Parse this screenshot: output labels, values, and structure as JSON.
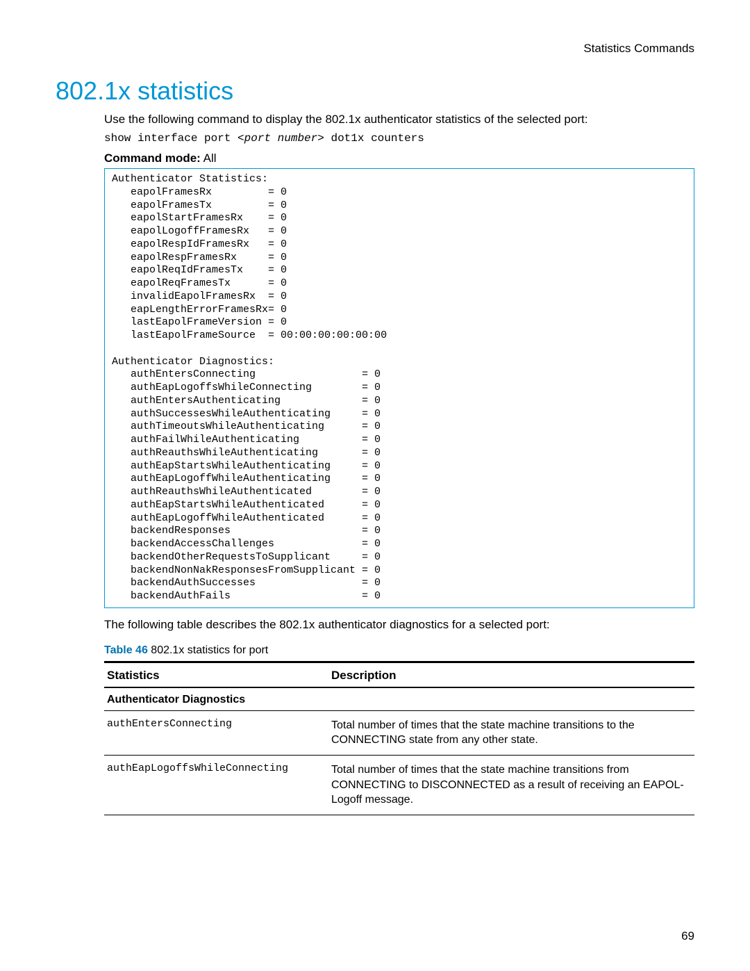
{
  "header": {
    "right_text": "Statistics Commands"
  },
  "title": "802.1x statistics",
  "intro": "Use the following command to display the 802.1x authenticator statistics of the selected port:",
  "command": {
    "prefix": "show interface port ",
    "arg": "<port number>",
    "suffix": " dot1x counters"
  },
  "mode": {
    "label": "Command mode:",
    "value": " All"
  },
  "output": {
    "stats_header": "Authenticator Statistics:",
    "stats": [
      {
        "k": "eapolFramesRx",
        "v": "0"
      },
      {
        "k": "eapolFramesTx",
        "v": "0"
      },
      {
        "k": "eapolStartFramesRx",
        "v": "0"
      },
      {
        "k": "eapolLogoffFramesRx",
        "v": "0"
      },
      {
        "k": "eapolRespIdFramesRx",
        "v": "0"
      },
      {
        "k": "eapolRespFramesRx",
        "v": "0"
      },
      {
        "k": "eapolReqIdFramesTx",
        "v": "0"
      },
      {
        "k": "eapolReqFramesTx",
        "v": "0"
      },
      {
        "k": "invalidEapolFramesRx",
        "v": "0"
      },
      {
        "k": "eapLengthErrorFramesRx",
        "v": "0"
      },
      {
        "k": "lastEapolFrameVersion",
        "v": "0"
      },
      {
        "k": "lastEapolFrameSource",
        "v": "00:00:00:00:00:00"
      }
    ],
    "diag_header": "Authenticator Diagnostics:",
    "diag": [
      {
        "k": "authEntersConnecting",
        "v": "0"
      },
      {
        "k": "authEapLogoffsWhileConnecting",
        "v": "0"
      },
      {
        "k": "authEntersAuthenticating",
        "v": "0"
      },
      {
        "k": "authSuccessesWhileAuthenticating",
        "v": "0"
      },
      {
        "k": "authTimeoutsWhileAuthenticating",
        "v": "0"
      },
      {
        "k": "authFailWhileAuthenticating",
        "v": "0"
      },
      {
        "k": "authReauthsWhileAuthenticating",
        "v": "0"
      },
      {
        "k": "authEapStartsWhileAuthenticating",
        "v": "0"
      },
      {
        "k": "authEapLogoffWhileAuthenticating",
        "v": "0"
      },
      {
        "k": "authReauthsWhileAuthenticated",
        "v": "0"
      },
      {
        "k": "authEapStartsWhileAuthenticated",
        "v": "0"
      },
      {
        "k": "authEapLogoffWhileAuthenticated",
        "v": "0"
      },
      {
        "k": "backendResponses",
        "v": "0"
      },
      {
        "k": "backendAccessChallenges",
        "v": "0"
      },
      {
        "k": "backendOtherRequestsToSupplicant",
        "v": "0"
      },
      {
        "k": "backendNonNakResponsesFromSupplicant",
        "v": "0"
      },
      {
        "k": "backendAuthSuccesses",
        "v": "0"
      },
      {
        "k": "backendAuthFails",
        "v": "0"
      }
    ]
  },
  "after_box": "The following table describes the 802.1x authenticator diagnostics for a selected port:",
  "table": {
    "caption_prefix": "Table 46",
    "caption_text": "  802.1x statistics for port",
    "headers": {
      "c1": "Statistics",
      "c2": "Description"
    },
    "section": "Authenticator Diagnostics",
    "rows": [
      {
        "stat": "authEntersConnecting",
        "desc": "Total number of times that the state machine transitions to the CONNECTING state from any other state."
      },
      {
        "stat": "authEapLogoffsWhileConnecting",
        "desc": "Total number of times that the state machine transitions from CONNECTING to DISCONNECTED as a result of receiving an EAPOL-Logoff message."
      }
    ]
  },
  "page_number": "69"
}
